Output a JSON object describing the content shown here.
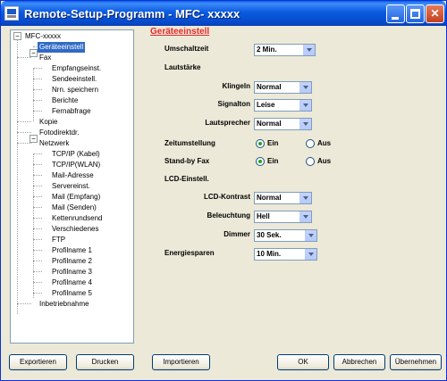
{
  "window": {
    "title": "Remote-Setup-Programm - MFC- xxxxx"
  },
  "tree": [
    {
      "label": "MFC-xxxxx"
    },
    {
      "label": "Geräteeinstell"
    },
    {
      "label": "Fax"
    },
    {
      "label": "Empfangseinst."
    },
    {
      "label": "Sendeeinstell."
    },
    {
      "label": "Nrn. speichern"
    },
    {
      "label": "Berichte"
    },
    {
      "label": "Fernabfrage"
    },
    {
      "label": "Kopie"
    },
    {
      "label": "Fotodirektdr."
    },
    {
      "label": "Netzwerk"
    },
    {
      "label": "TCP/IP (Kabel)"
    },
    {
      "label": "TCP/IP(WLAN)"
    },
    {
      "label": "Mail-Adresse"
    },
    {
      "label": "Servereinst."
    },
    {
      "label": "Mail (Empfang)"
    },
    {
      "label": "Mail (Senden)"
    },
    {
      "label": "Kettenrundsend"
    },
    {
      "label": "Verschiedenes"
    },
    {
      "label": "FTP"
    },
    {
      "label": "Profilname 1"
    },
    {
      "label": "Profilname 2"
    },
    {
      "label": "Profilname 3"
    },
    {
      "label": "Profilname 4"
    },
    {
      "label": "Profilname 5"
    },
    {
      "label": "Inbetriebnahme"
    }
  ],
  "panel": {
    "title": "Geräteeinstell",
    "umschaltzeit": {
      "label": "Umschaltzeit",
      "value": "2 Min."
    },
    "lautstaerke_header": "Lautstärke",
    "klingeln": {
      "label": "Klingeln",
      "value": "Normal"
    },
    "signalton": {
      "label": "Signalton",
      "value": "Leise"
    },
    "lautsprecher": {
      "label": "Lautsprecher",
      "value": "Normal"
    },
    "zeitumstellung": {
      "label": "Zeitumstellung",
      "on": "Ein",
      "off": "Aus",
      "selected": "Ein"
    },
    "standby_fax": {
      "label": "Stand-by Fax",
      "on": "Ein",
      "off": "Aus",
      "selected": "Ein"
    },
    "lcd_header": "LCD-Einstell.",
    "lcd_kontrast": {
      "label": "LCD-Kontrast",
      "value": "Normal"
    },
    "beleuchtung": {
      "label": "Beleuchtung",
      "value": "Hell"
    },
    "dimmer": {
      "label": "Dimmer",
      "value": "30 Sek."
    },
    "energiesparen": {
      "label": "Energiesparen",
      "value": "10 Min."
    }
  },
  "buttons": {
    "exportieren": "Exportieren",
    "drucken": "Drucken",
    "importieren": "Importieren",
    "ok": "OK",
    "abbrechen": "Abbrechen",
    "uebernehmen": "Übernehmen"
  },
  "colors": {
    "accent_title": "#e8282a",
    "selection": "#316ac5",
    "titlebar": "#0a5be0"
  }
}
